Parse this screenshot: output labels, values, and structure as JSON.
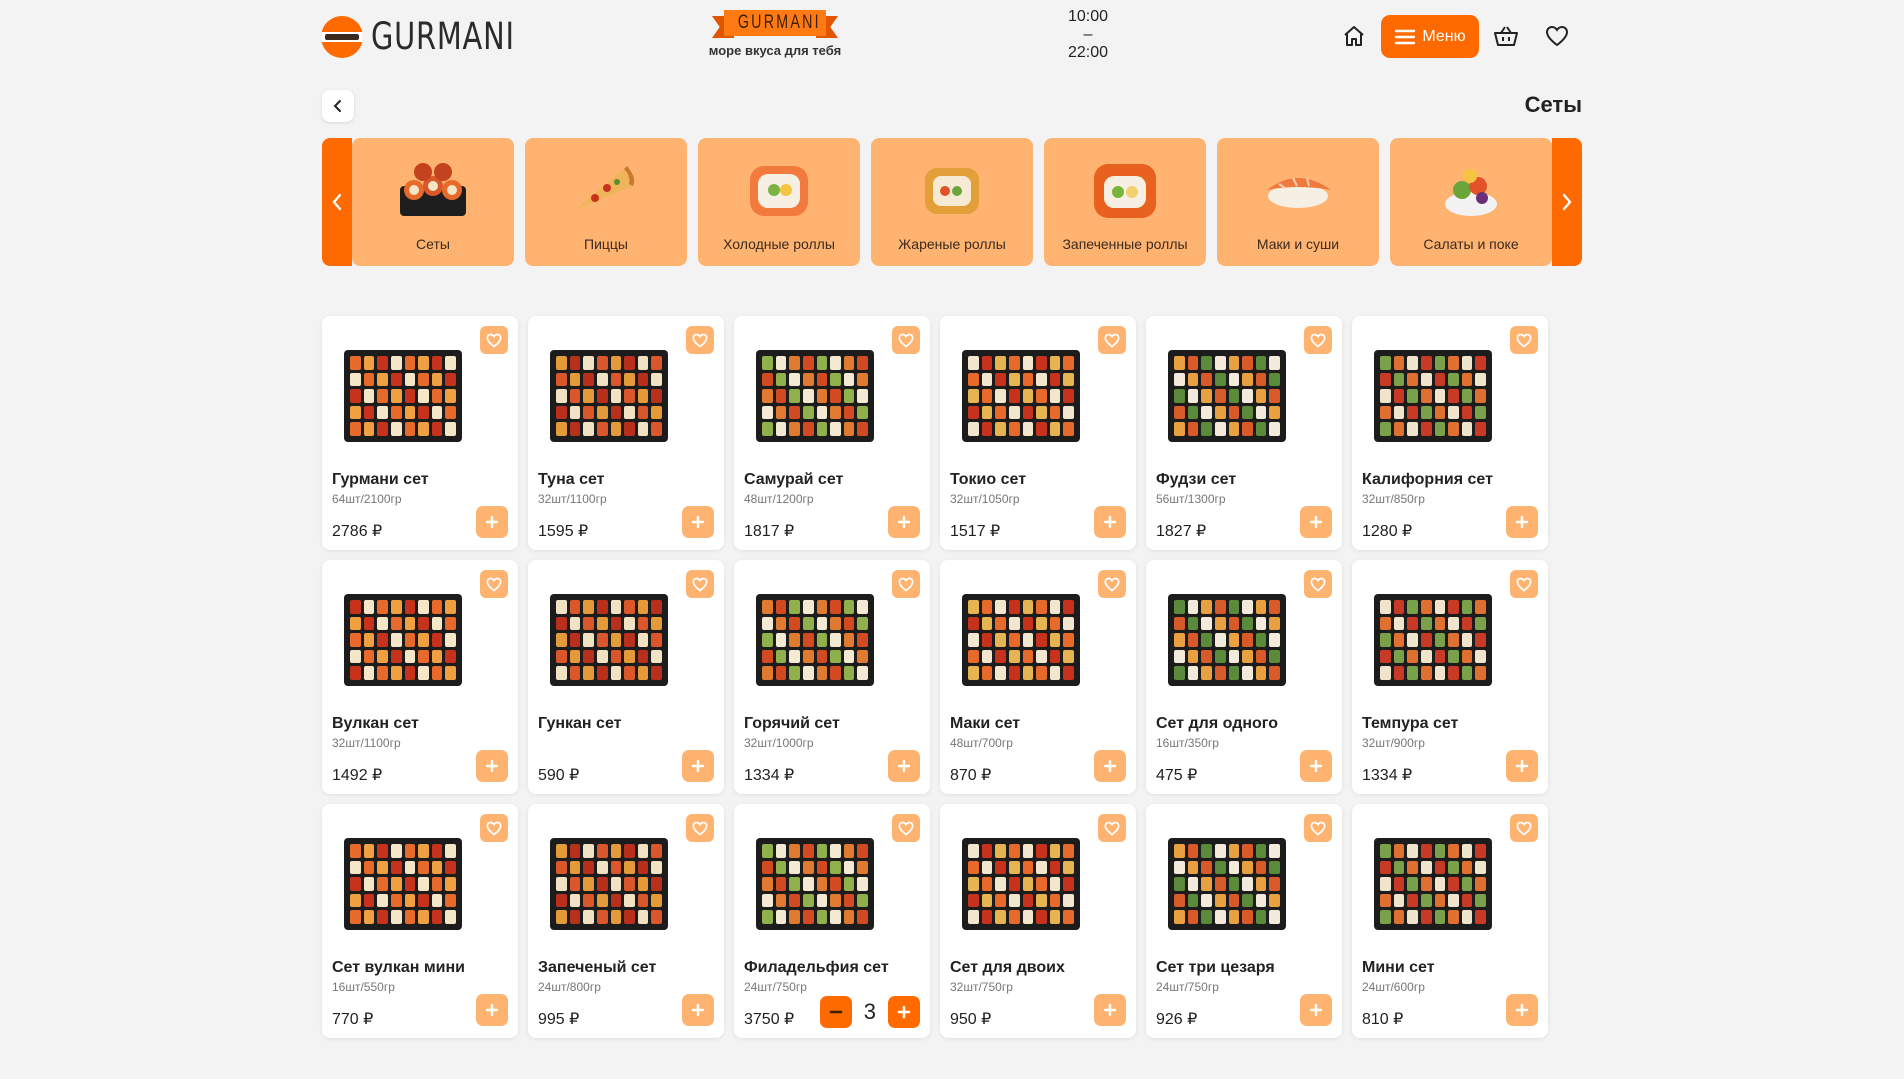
{
  "header": {
    "logo_text": "GURMANI",
    "brand_ribbon": "GURMANI",
    "tagline": "море вкуса для тебя",
    "hours_open": "10:00",
    "hours_sep": "–",
    "hours_close": "22:00",
    "menu_label": "Меню"
  },
  "page": {
    "title": "Сеты"
  },
  "categories": [
    {
      "label": "Сеты",
      "icon": "rolls-set"
    },
    {
      "label": "Пиццы",
      "icon": "pizza-slice"
    },
    {
      "label": "Холодные роллы",
      "icon": "cold-roll"
    },
    {
      "label": "Жареные роллы",
      "icon": "fried-roll"
    },
    {
      "label": "Запеченные роллы",
      "icon": "baked-roll"
    },
    {
      "label": "Маки и суши",
      "icon": "nigiri"
    },
    {
      "label": "Салаты и поке",
      "icon": "salad"
    }
  ],
  "colors": {
    "accent": "#ff6a00",
    "accent_light": "#ffb370",
    "background": "#f3f3f3"
  },
  "products": [
    {
      "name": "Гурмани сет",
      "meta": "64шт/2100гр",
      "price": "2786 ₽"
    },
    {
      "name": "Туна сет",
      "meta": "32шт/1100гр",
      "price": "1595 ₽"
    },
    {
      "name": "Самурай сет",
      "meta": "48шт/1200гр",
      "price": "1817 ₽"
    },
    {
      "name": "Токио сет",
      "meta": "32шт/1050гр",
      "price": "1517 ₽"
    },
    {
      "name": "Фудзи сет",
      "meta": "56шт/1300гр",
      "price": "1827 ₽"
    },
    {
      "name": "Калифорния сет",
      "meta": "32шт/850гр",
      "price": "1280 ₽"
    },
    {
      "name": "Вулкан сет",
      "meta": "32шт/1100гр",
      "price": "1492 ₽"
    },
    {
      "name": "Гункан сет",
      "meta": "",
      "price": "590 ₽"
    },
    {
      "name": "Горячий сет",
      "meta": "32шт/1000гр",
      "price": "1334 ₽"
    },
    {
      "name": "Маки сет",
      "meta": "48шт/700гр",
      "price": "870 ₽"
    },
    {
      "name": "Сет для одного",
      "meta": "16шт/350гр",
      "price": "475 ₽"
    },
    {
      "name": "Темпура сет",
      "meta": "32шт/900гр",
      "price": "1334 ₽"
    },
    {
      "name": "Сет вулкан мини",
      "meta": "16шт/550гр",
      "price": "770 ₽"
    },
    {
      "name": "Запеченый сет",
      "meta": "24шт/800гр",
      "price": "995 ₽"
    },
    {
      "name": "Филадельфия сет",
      "meta": "24шт/750гр",
      "price": "3750 ₽",
      "quantity": "3"
    },
    {
      "name": "Сет для двоих",
      "meta": "32шт/750гр",
      "price": "950 ₽"
    },
    {
      "name": "Сет три цезаря",
      "meta": "24шт/750гр",
      "price": "926 ₽"
    },
    {
      "name": "Мини сет",
      "meta": "24шт/600гр",
      "price": "810 ₽"
    }
  ]
}
